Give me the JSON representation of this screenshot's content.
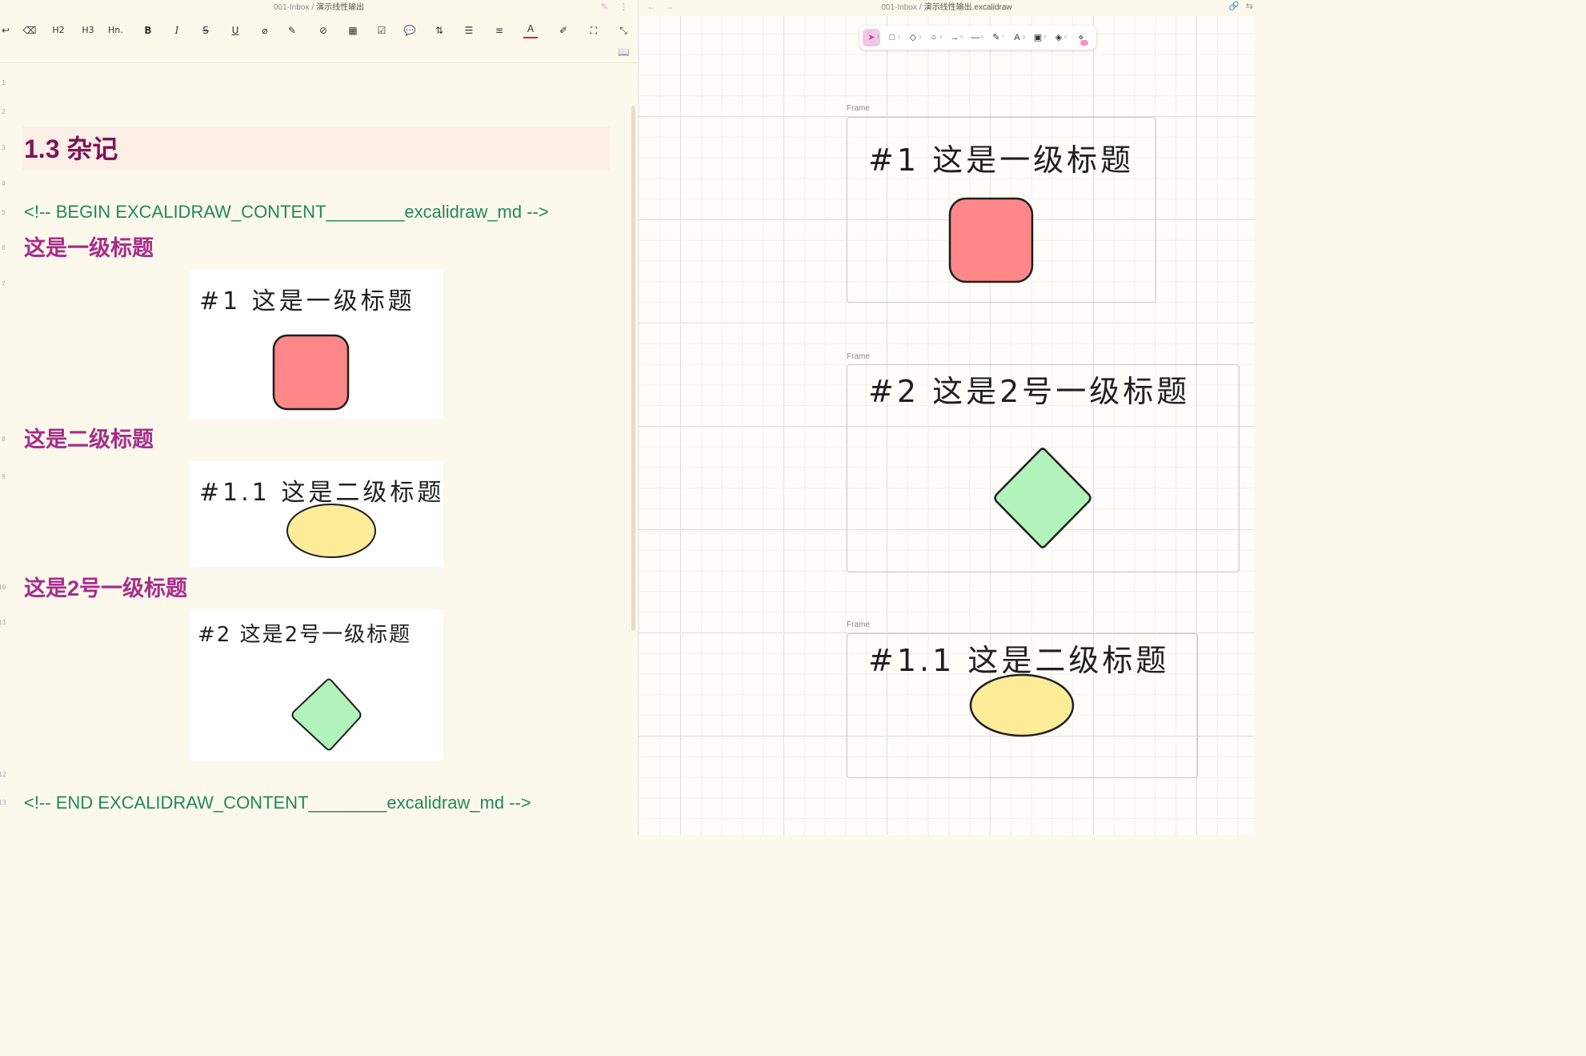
{
  "left": {
    "breadcrumb": {
      "folder": "001-Inbox",
      "separator": "/",
      "file": "演示线性输出"
    },
    "toolbar": {
      "h2": "H2",
      "h3": "H3",
      "hn": "Hn.",
      "bold": "B",
      "italic": "I",
      "strike": "S",
      "underline": "U",
      "font_color": "A"
    },
    "line_numbers": [
      "1",
      "2",
      "3",
      "4",
      "5",
      "6",
      "7",
      "8",
      "9",
      "10",
      "11",
      "12",
      "13"
    ],
    "heading": "1.3 杂记",
    "comment_begin": "<!-- BEGIN EXCALIDRAW_CONTENT________excalidraw_md -->",
    "comment_end": "<!-- END EXCALIDRAW_CONTENT________excalidraw_md -->",
    "sections": [
      {
        "title": "这是一级标题",
        "drawing_text": "#1 这是一级标题"
      },
      {
        "title": "这是二级标题",
        "drawing_text": "#1.1 这是二级标题"
      },
      {
        "title": "这是2号一级标题",
        "drawing_text": "#2 这是2号一级标题"
      }
    ]
  },
  "right": {
    "breadcrumb": {
      "folder": "001-Inbox",
      "separator": "/",
      "file": "演示线性输出.excalidraw"
    },
    "frames": [
      {
        "label": "Frame",
        "text": "#1 这是一级标题",
        "shape": "rounded-rectangle",
        "fill": "#ff8787"
      },
      {
        "label": "Frame",
        "text": "#2 这是2号一级标题",
        "shape": "diamond",
        "fill": "#b2f2bb"
      },
      {
        "label": "Frame",
        "text": "#1.1 这是二级标题",
        "shape": "ellipse",
        "fill": "#ffec99"
      }
    ]
  },
  "colors": {
    "heading": "#7c1558",
    "subheading": "#a52d8a",
    "comment": "#1f8a55",
    "shape_red": "#ff8787",
    "shape_green": "#b2f2bb",
    "shape_yellow": "#ffec99",
    "tool_selected": "#f3c8e6"
  }
}
